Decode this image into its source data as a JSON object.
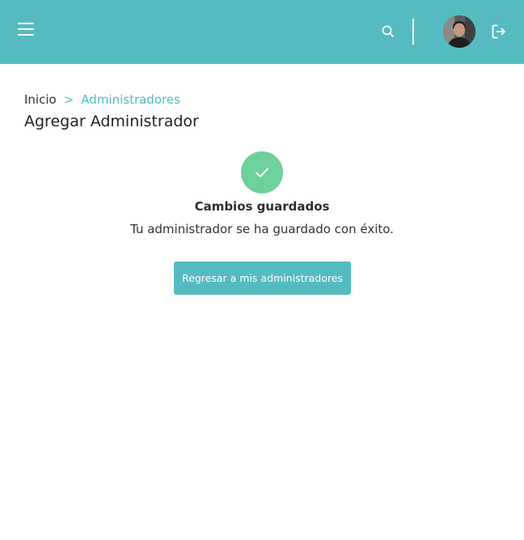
{
  "header": {
    "bg_color": "#54bcc1",
    "menu_icon": "hamburger-menu-icon",
    "search_icon": "search-icon",
    "avatar_alt": "user-avatar",
    "logout_icon": "logout-icon"
  },
  "breadcrumb": {
    "home": "Inicio",
    "separator": ">",
    "current": "Administradores"
  },
  "page": {
    "title": "Agregar Administrador"
  },
  "success": {
    "icon": "check-icon",
    "circle_color": "#6ed09a",
    "title": "Cambios guardados",
    "message": "Tu administrador se ha guardado con éxito.",
    "button_label": "Regresar a mis administradores"
  }
}
